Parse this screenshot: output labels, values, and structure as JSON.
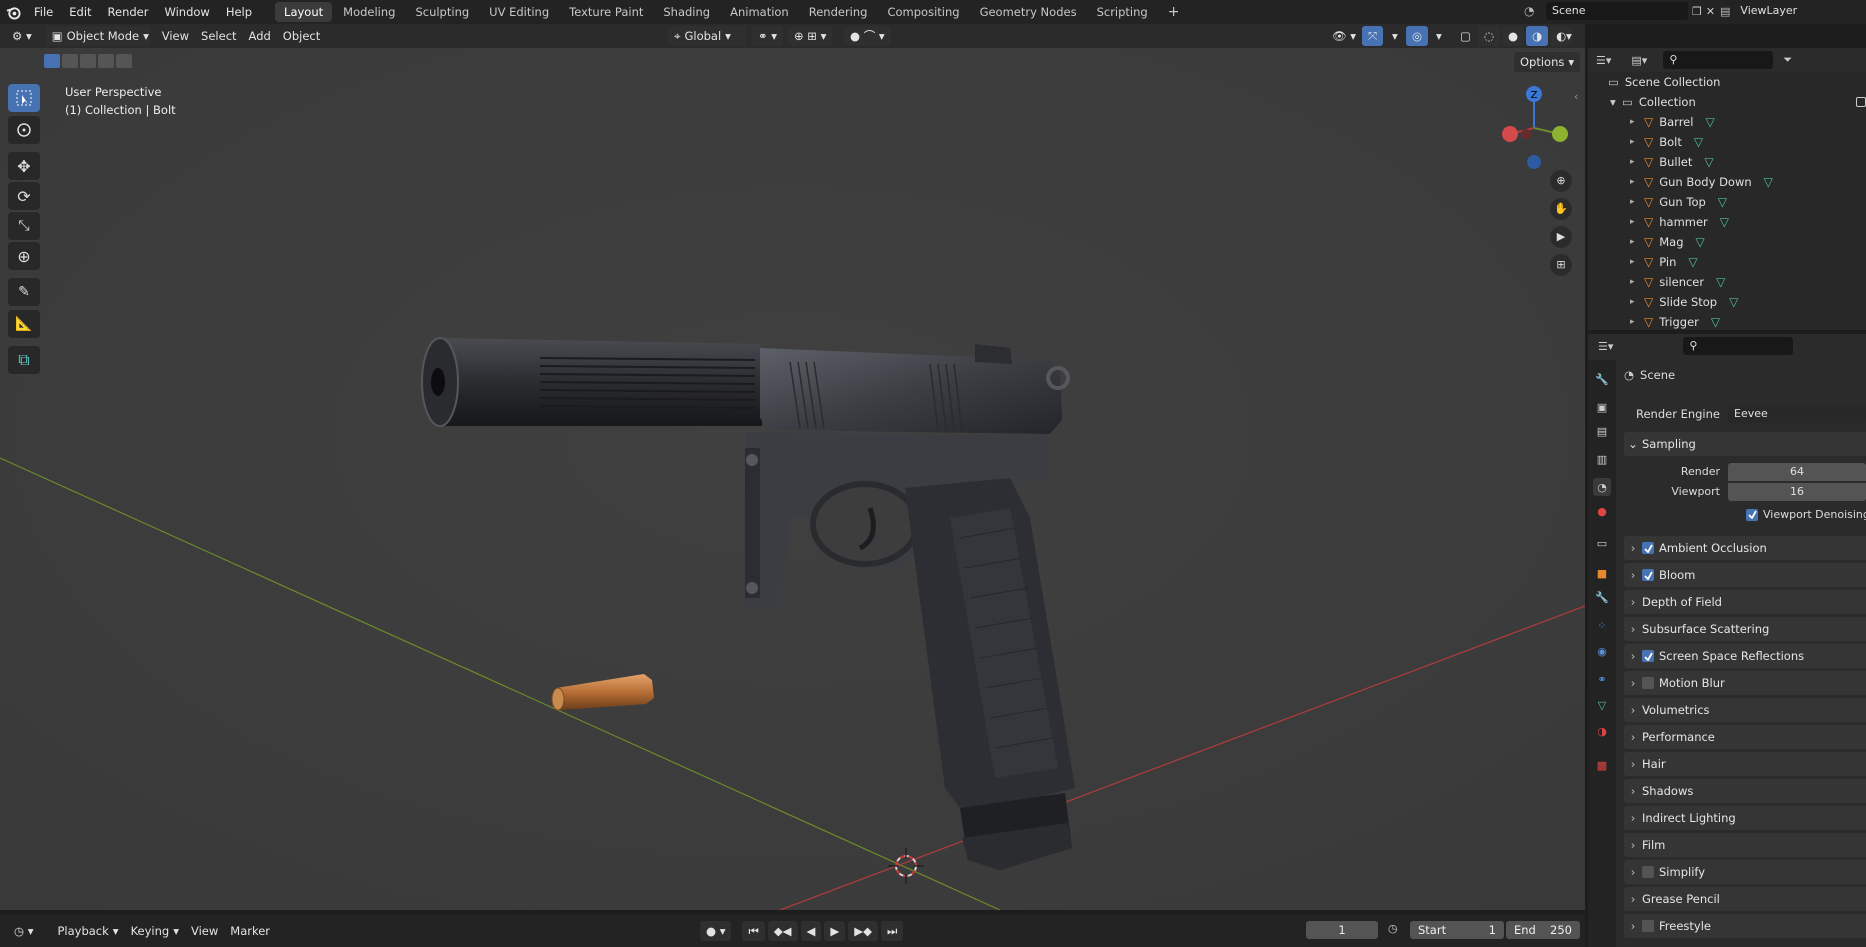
{
  "topbar": {
    "menus": [
      "File",
      "Edit",
      "Render",
      "Window",
      "Help"
    ],
    "workspaces": [
      "Layout",
      "Modeling",
      "Sculpting",
      "UV Editing",
      "Texture Paint",
      "Shading",
      "Animation",
      "Rendering",
      "Compositing",
      "Geometry Nodes",
      "Scripting"
    ],
    "active_workspace": "Layout",
    "scene": "Scene",
    "view_layer": "ViewLayer"
  },
  "viewport_header": {
    "mode": "Object Mode",
    "menus": [
      "View",
      "Select",
      "Add",
      "Object"
    ],
    "orientation": "Global",
    "options": "Options"
  },
  "viewport": {
    "view_name": "User Perspective",
    "context": "(1) Collection | Bolt",
    "gizmo_axes": {
      "z": "Z"
    },
    "colors": {
      "x_axis": "#b43c3c",
      "y_axis": "#6c8a2a",
      "z_axis": "#3a78d8"
    }
  },
  "outliner": {
    "root": "Scene Collection",
    "collection": "Collection",
    "items": [
      "Barrel",
      "Bolt",
      "Bullet",
      "Gun Body Down",
      "Gun Top",
      "hammer",
      "Mag",
      "Pin",
      "silencer",
      "Slide Stop",
      "Trigger"
    ]
  },
  "properties": {
    "header": "Scene",
    "render_engine_label": "Render Engine",
    "render_engine": "Eevee",
    "sampling": {
      "title": "Sampling",
      "render_label": "Render",
      "render_value": "64",
      "viewport_label": "Viewport",
      "viewport_value": "16",
      "denoise_label": "Viewport Denoising"
    },
    "panels": [
      {
        "label": "Ambient Occlusion",
        "checkbox": "on"
      },
      {
        "label": "Bloom",
        "checkbox": "on"
      },
      {
        "label": "Depth of Field",
        "checkbox": "none"
      },
      {
        "label": "Subsurface Scattering",
        "checkbox": "none"
      },
      {
        "label": "Screen Space Reflections",
        "checkbox": "on"
      },
      {
        "label": "Motion Blur",
        "checkbox": "off"
      },
      {
        "label": "Volumetrics",
        "checkbox": "none"
      },
      {
        "label": "Performance",
        "checkbox": "none"
      },
      {
        "label": "Hair",
        "checkbox": "none"
      },
      {
        "label": "Shadows",
        "checkbox": "none"
      },
      {
        "label": "Indirect Lighting",
        "checkbox": "none"
      },
      {
        "label": "Film",
        "checkbox": "none"
      },
      {
        "label": "Simplify",
        "checkbox": "off"
      },
      {
        "label": "Grease Pencil",
        "checkbox": "none"
      },
      {
        "label": "Freestyle",
        "checkbox": "off"
      }
    ]
  },
  "timeline": {
    "menus": [
      "Playback",
      "Keying",
      "View",
      "Marker"
    ],
    "current_frame": "1",
    "start_label": "Start",
    "start": "1",
    "end_label": "End",
    "end": "250"
  }
}
